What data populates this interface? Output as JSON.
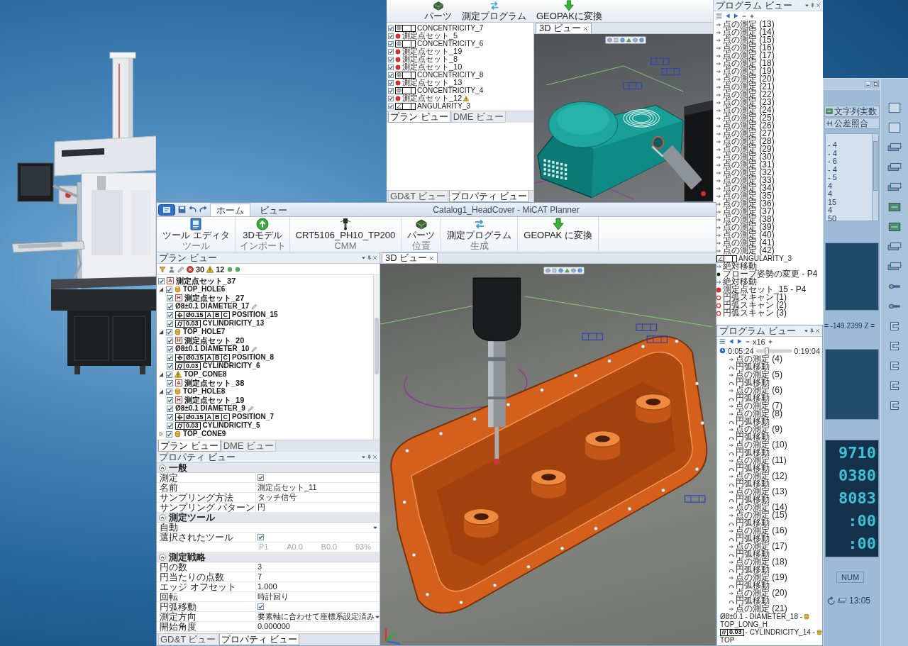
{
  "background_window": {
    "toolbar_buttons": [
      {
        "kind": "string",
        "label": "文字列実数"
      },
      {
        "kind": "tolerance",
        "label": "公差照合"
      }
    ],
    "list_items": [
      "- 4",
      "- 4",
      "- 6",
      "- 4",
      "- 5",
      "4",
      "4",
      "15",
      "4",
      "50"
    ],
    "coordinate_readout": "= -149.2399 Z =",
    "counter_readouts": [
      "9710",
      "0380",
      "8083",
      ":00",
      ":00"
    ],
    "status_indicator": "NUM",
    "clock": "13:05"
  },
  "top_window": {
    "ribbon_buttons": [
      {
        "kind": "parts",
        "label": "パーツ"
      },
      {
        "kind": "program",
        "label": "測定プログラム"
      },
      {
        "kind": "convert",
        "label": "GEOPAKに変換"
      }
    ],
    "plan_tree": [
      {
        "kind": "tolerance",
        "frame": {
          "kind": "concentricity"
        },
        "label": "CONCENTRICITY_7",
        "checked": true
      },
      {
        "kind": "points",
        "label": "測定点セット_5",
        "checked": true
      },
      {
        "kind": "tolerance",
        "frame": {
          "kind": "concentricity"
        },
        "label": "CONCENTRICITY_6",
        "checked": true
      },
      {
        "kind": "points",
        "label": "測定点セット_19",
        "checked": true
      },
      {
        "kind": "points",
        "label": "測定点セット_8",
        "checked": true
      },
      {
        "kind": "points",
        "label": "測定点セット_10",
        "checked": true
      },
      {
        "kind": "tolerance",
        "frame": {
          "kind": "concentricity"
        },
        "label": "CONCENTRICITY_8",
        "checked": true
      },
      {
        "kind": "points",
        "label": "測定点セット_13",
        "checked": true
      },
      {
        "kind": "tolerance",
        "frame": {
          "kind": "concentricity"
        },
        "label": "CONCENTRICITY_4",
        "checked": true
      },
      {
        "kind": "points",
        "label": "測定点セット_12",
        "checked": true,
        "warning": true
      },
      {
        "kind": "tolerance",
        "frame": {
          "kind": "angularity"
        },
        "label": "ANGULARITY_3",
        "checked": true
      }
    ],
    "plan_tabs": [
      {
        "label": "プラン ビュー",
        "selected": true
      },
      {
        "label": "DME ビュー",
        "selected": false
      }
    ],
    "property_tabs": [
      {
        "label": "GD&T ビュー",
        "selected": false
      },
      {
        "label": "プロパティ ビュー",
        "selected": true
      }
    ],
    "view_tab": "3D ビュー",
    "program_view": {
      "title": "プログラム ビュー",
      "steps": [
        {
          "kind": "point",
          "label": "点の測定 (13)"
        },
        {
          "kind": "point",
          "label": "点の測定 (14)"
        },
        {
          "kind": "point",
          "label": "点の測定 (15)"
        },
        {
          "kind": "point",
          "label": "点の測定 (16)"
        },
        {
          "kind": "point",
          "label": "点の測定 (17)"
        },
        {
          "kind": "point",
          "label": "点の測定 (18)"
        },
        {
          "kind": "point",
          "label": "点の測定 (19)"
        },
        {
          "kind": "point",
          "label": "点の測定 (20)"
        },
        {
          "kind": "point",
          "label": "点の測定 (21)"
        },
        {
          "kind": "point",
          "label": "点の測定 (22)"
        },
        {
          "kind": "point",
          "label": "点の測定 (23)"
        },
        {
          "kind": "point",
          "label": "点の測定 (24)"
        },
        {
          "kind": "point",
          "label": "点の測定 (25)"
        },
        {
          "kind": "point",
          "label": "点の測定 (26)"
        },
        {
          "kind": "point",
          "label": "点の測定 (27)"
        },
        {
          "kind": "point",
          "label": "点の測定 (28)"
        },
        {
          "kind": "point",
          "label": "点の測定 (29)"
        },
        {
          "kind": "point",
          "label": "点の測定 (30)"
        },
        {
          "kind": "point",
          "label": "点の測定 (31)"
        },
        {
          "kind": "point",
          "label": "点の測定 (32)"
        },
        {
          "kind": "point",
          "label": "点の測定 (33)"
        },
        {
          "kind": "point",
          "label": "点の測定 (34)"
        },
        {
          "kind": "point",
          "label": "点の測定 (35)"
        },
        {
          "kind": "point",
          "label": "点の測定 (36)"
        },
        {
          "kind": "point",
          "label": "点の測定 (37)"
        },
        {
          "kind": "point",
          "label": "点の測定 (38)"
        },
        {
          "kind": "point",
          "label": "点の測定 (39)"
        },
        {
          "kind": "point",
          "label": "点の測定 (40)"
        },
        {
          "kind": "point",
          "label": "点の測定 (41)"
        },
        {
          "kind": "point",
          "label": "点の測定 (42)"
        },
        {
          "kind": "tolerance",
          "frame": {
            "kind": "angularity"
          },
          "label": "ANGULARITY_3"
        },
        {
          "kind": "move",
          "label": "絶対移動"
        },
        {
          "kind": "probe",
          "label": "プローブ姿勢の変更 - P4"
        },
        {
          "kind": "move",
          "label": "絶対移動"
        },
        {
          "kind": "pointset",
          "label": "測定点セット_15 - P4"
        },
        {
          "kind": "scan",
          "label": "円弧スキャン (1)"
        },
        {
          "kind": "scan",
          "label": "円弧スキャン (2)"
        },
        {
          "kind": "scan",
          "label": "円弧スキャン (3)"
        }
      ]
    }
  },
  "lower_window": {
    "title": "Catalog1_HeadCover - MiCAT Planner",
    "ribbon_tabs": [
      {
        "label": "ホーム",
        "selected": true
      },
      {
        "label": "ビュー",
        "selected": false
      }
    ],
    "ribbon_groups": [
      {
        "label": "ツール",
        "buttons": [
          {
            "kind": "tool_editor",
            "label": "ツール エディタ"
          }
        ]
      },
      {
        "label": "インポート",
        "buttons": [
          {
            "kind": "model",
            "label": "3Dモデル"
          }
        ]
      },
      {
        "label": "CMM",
        "buttons": [
          {
            "kind": "cmm",
            "label": "CRT5106_PH10_TP200"
          }
        ]
      },
      {
        "label": "位置",
        "buttons": [
          {
            "kind": "parts",
            "label": "パーツ"
          }
        ]
      },
      {
        "label": "生成",
        "buttons": [
          {
            "kind": "program",
            "label": "測定プログラム"
          }
        ]
      },
      {
        "buttons": [
          {
            "kind": "convert",
            "label": "GEOPAK に変換"
          }
        ]
      }
    ],
    "plan_view": {
      "title": "プラン ビュー",
      "error_count": "30",
      "warning_count": "12",
      "tree": [
        {
          "kind": "points",
          "badge": "A",
          "label": "測定点セット_37",
          "checked": true
        },
        {
          "kind": "feature",
          "label": "TOP_HOLE6",
          "checked": true,
          "expanded": true,
          "warning": false,
          "children": [
            {
              "kind": "points",
              "badge": "H",
              "label": "測定点セット_27",
              "checked": true
            },
            {
              "kind": "dimension",
              "label": "Ø8±0.1 DIAMETER_17",
              "checked": true,
              "annotated": true
            },
            {
              "kind": "tolerance",
              "frame": {
                "kind": "position",
                "cells": [
                  "Ø0.15",
                  "A",
                  "B",
                  "C"
                ]
              },
              "label": "POSITION_15",
              "checked": true
            },
            {
              "kind": "tolerance",
              "frame": {
                "kind": "cylindricity",
                "cells": [
                  "0.03"
                ]
              },
              "label": "CYLINDRICITY_13",
              "checked": true
            }
          ]
        },
        {
          "kind": "feature",
          "label": "TOP_HOLE7",
          "checked": true,
          "expanded": true,
          "warning": false,
          "children": [
            {
              "kind": "points",
              "badge": "H",
              "label": "測定点セット_20",
              "checked": true
            },
            {
              "kind": "dimension",
              "label": "Ø8±0.1 DIAMETER_10",
              "checked": true,
              "annotated": true
            },
            {
              "kind": "tolerance",
              "frame": {
                "kind": "position",
                "cells": [
                  "Ø0.15",
                  "A",
                  "B",
                  "C"
                ]
              },
              "label": "POSITION_8",
              "checked": true
            },
            {
              "kind": "tolerance",
              "frame": {
                "kind": "cylindricity",
                "cells": [
                  "0.03"
                ]
              },
              "label": "CYLINDRICITY_6",
              "checked": true
            }
          ]
        },
        {
          "kind": "feature",
          "label": "TOP_CONE8",
          "checked": true,
          "expanded": true,
          "warning": true,
          "children": [
            {
              "kind": "points",
              "badge": "A",
              "label": "測定点セット_38",
              "checked": true
            }
          ]
        },
        {
          "kind": "feature",
          "label": "TOP_HOLE8",
          "checked": true,
          "expanded": true,
          "warning": false,
          "children": [
            {
              "kind": "points",
              "badge": "H",
              "label": "測定点セット_19",
              "checked": true
            },
            {
              "kind": "dimension",
              "label": "Ø8±0.1 DIAMETER_9",
              "checked": true,
              "annotated": true
            },
            {
              "kind": "tolerance",
              "frame": {
                "kind": "position",
                "cells": [
                  "Ø0.15",
                  "A",
                  "B",
                  "C"
                ]
              },
              "label": "POSITION_7",
              "checked": true
            },
            {
              "kind": "tolerance",
              "frame": {
                "kind": "cylindricity",
                "cells": [
                  "0.03"
                ]
              },
              "label": "CYLINDRICITY_5",
              "checked": true
            }
          ]
        },
        {
          "kind": "feature",
          "label": "TOP_CONE9",
          "checked": true,
          "expanded": false,
          "warning": false
        }
      ]
    },
    "plan_tabs": [
      {
        "label": "プラン ビュー",
        "selected": true
      },
      {
        "label": "DME ビュー",
        "selected": false
      }
    ],
    "property_view": {
      "title": "プロパティ ビュー",
      "sections": [
        {
          "title": "一般",
          "expanded": true,
          "rows": [
            {
              "kind": "check",
              "label": "測定",
              "checked": true
            },
            {
              "kind": "text",
              "label": "名前",
              "value": "測定点セット_11"
            },
            {
              "kind": "text",
              "label": "サンプリング方法",
              "value": "タッチ信号"
            },
            {
              "kind": "text",
              "label": "サンプリング パターン",
              "value": "円"
            }
          ]
        },
        {
          "title": "測定ツール",
          "expanded": true,
          "rows": [
            {
              "kind": "dropdown",
              "value": "自動"
            },
            {
              "kind": "check",
              "label": "選択されたツール",
              "checked": true
            },
            {
              "kind": "readonly",
              "values": [
                "P1",
                "A0.0",
                "B0.0",
                "93%"
              ]
            }
          ]
        },
        {
          "title": "測定戦略",
          "expanded": true,
          "rows": [
            {
              "kind": "text",
              "label": "円の数",
              "value": "3"
            },
            {
              "kind": "text",
              "label": "円当たりの点数",
              "value": "7"
            },
            {
              "kind": "text",
              "label": "エッジ オフセット",
              "value": "1.000"
            },
            {
              "kind": "text",
              "label": "回転",
              "value": "時計回り"
            },
            {
              "kind": "check",
              "label": "円弧移動",
              "checked": true
            },
            {
              "kind": "dropdown",
              "label": "測定方向",
              "value": "要素軸に合わせて座標系設定済み"
            },
            {
              "kind": "text",
              "label": "開始角度",
              "value": "0.000000"
            }
          ]
        }
      ]
    },
    "property_tabs": [
      {
        "label": "GD&T ビュー",
        "selected": false
      },
      {
        "label": "プロパティ ビュー",
        "selected": true
      }
    ],
    "view_tab": "3D ビュー",
    "program_view": {
      "title": "プログラム ビュー",
      "speed": "x16",
      "elapsed": "0:05:24",
      "total": "0:19:04",
      "level": 0.3,
      "steps": [
        {
          "kind": "point",
          "label": "点の測定 (4)"
        },
        {
          "kind": "arc",
          "label": "円弧移動"
        },
        {
          "kind": "point",
          "label": "点の測定 (5)"
        },
        {
          "kind": "arc",
          "label": "円弧移動"
        },
        {
          "kind": "point",
          "label": "点の測定 (6)"
        },
        {
          "kind": "arc",
          "label": "円弧移動"
        },
        {
          "kind": "point",
          "label": "点の測定 (7)"
        },
        {
          "kind": "point",
          "label": "点の測定 (8)"
        },
        {
          "kind": "arc",
          "label": "円弧移動"
        },
        {
          "kind": "point",
          "label": "点の測定 (9)"
        },
        {
          "kind": "arc",
          "label": "円弧移動"
        },
        {
          "kind": "point",
          "label": "点の測定 (10)"
        },
        {
          "kind": "arc",
          "label": "円弧移動"
        },
        {
          "kind": "point",
          "label": "点の測定 (11)"
        },
        {
          "kind": "arc",
          "label": "円弧移動"
        },
        {
          "kind": "point",
          "label": "点の測定 (12)"
        },
        {
          "kind": "arc",
          "label": "円弧移動"
        },
        {
          "kind": "point",
          "label": "点の測定 (13)"
        },
        {
          "kind": "arc",
          "label": "円弧移動"
        },
        {
          "kind": "point",
          "label": "点の測定 (14)"
        },
        {
          "kind": "point",
          "label": "点の測定 (15)"
        },
        {
          "kind": "arc",
          "label": "円弧移動"
        },
        {
          "kind": "point",
          "label": "点の測定 (16)"
        },
        {
          "kind": "arc",
          "label": "円弧移動"
        },
        {
          "kind": "point",
          "label": "点の測定 (17)"
        },
        {
          "kind": "arc",
          "label": "円弧移動"
        },
        {
          "kind": "point",
          "label": "点の測定 (18)"
        },
        {
          "kind": "arc",
          "label": "円弧移動"
        },
        {
          "kind": "point",
          "label": "点の測定 (19)"
        },
        {
          "kind": "arc",
          "label": "円弧移動"
        },
        {
          "kind": "point",
          "label": "点の測定 (20)"
        },
        {
          "kind": "arc",
          "label": "円弧移動"
        },
        {
          "kind": "point",
          "label": "点の測定 (21)"
        },
        {
          "kind": "dimension",
          "label": "Ø8±0.1 - DIAMETER_18 -",
          "feature": "TOP_LONG_H"
        },
        {
          "kind": "tolerance",
          "frame": {
            "kind": "cylindricity",
            "cells": [
              "0.03"
            ]
          },
          "label": "- CYLINDRICITY_14 -",
          "feature": "TOP"
        }
      ]
    }
  }
}
